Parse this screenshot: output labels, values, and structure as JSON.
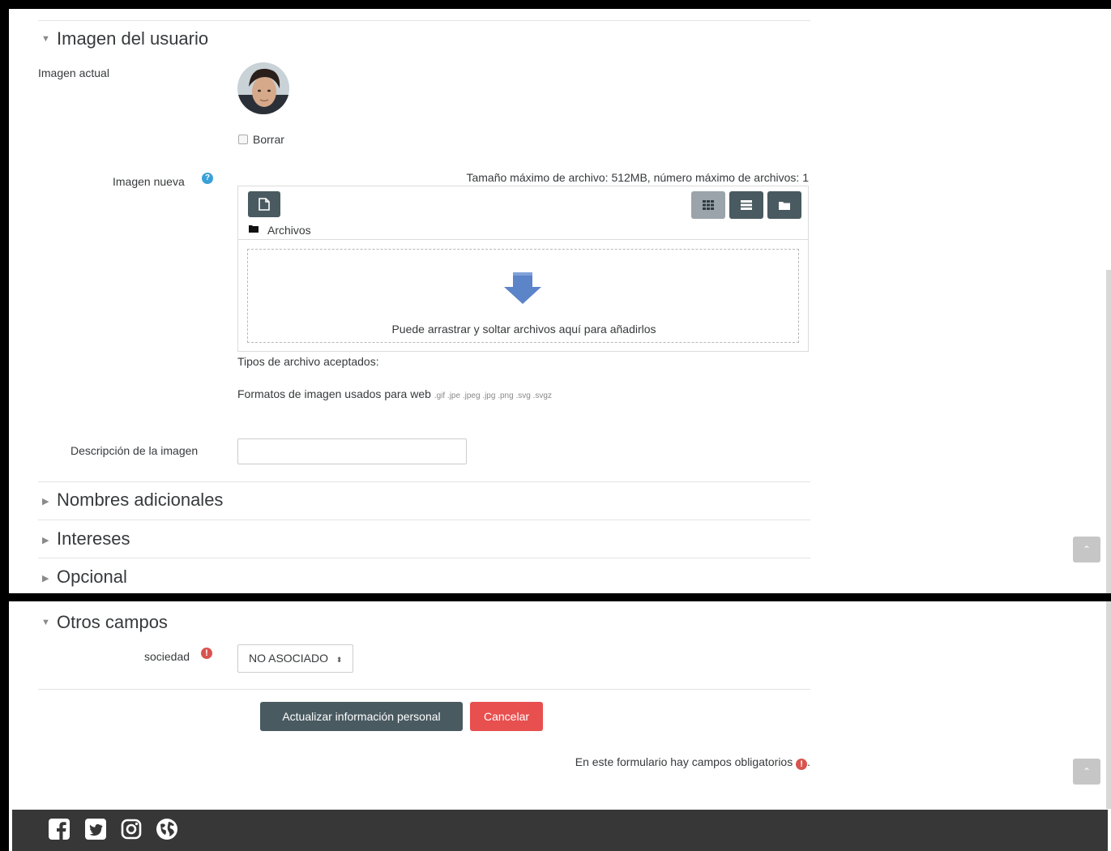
{
  "user_image": {
    "section_title": "Imagen del usuario",
    "current_label": "Imagen actual",
    "delete_label": "Borrar",
    "new_label": "Imagen nueva",
    "max_size_text": "Tamaño máximo de archivo: 512MB, número máximo de archivos: 1",
    "breadcrumb_folder": "Archivos",
    "drop_text": "Puede arrastrar y soltar archivos aquí para añadirlos",
    "accepted_types_label": "Tipos de archivo aceptados:",
    "formats_label": "Formatos de imagen usados para web",
    "formats_ext": ".gif .jpe .jpeg .jpg .png .svg .svgz",
    "description_label": "Descripción de la imagen",
    "description_value": ""
  },
  "sections": {
    "additional_names": "Nombres adicionales",
    "interests": "Intereses",
    "optional": "Opcional",
    "other_fields": "Otros campos"
  },
  "other_fields": {
    "society_label": "sociedad",
    "society_value": "NO ASOCIADO"
  },
  "actions": {
    "update_label": "Actualizar información personal",
    "cancel_label": "Cancelar",
    "required_note": "En este formulario hay campos obligatorios",
    "required_note_end": "."
  },
  "colors": {
    "primary": "#495a60",
    "danger": "#e84f4f",
    "info": "#3aa0d8",
    "arrow": "#5b84c9",
    "footer": "#373737"
  }
}
